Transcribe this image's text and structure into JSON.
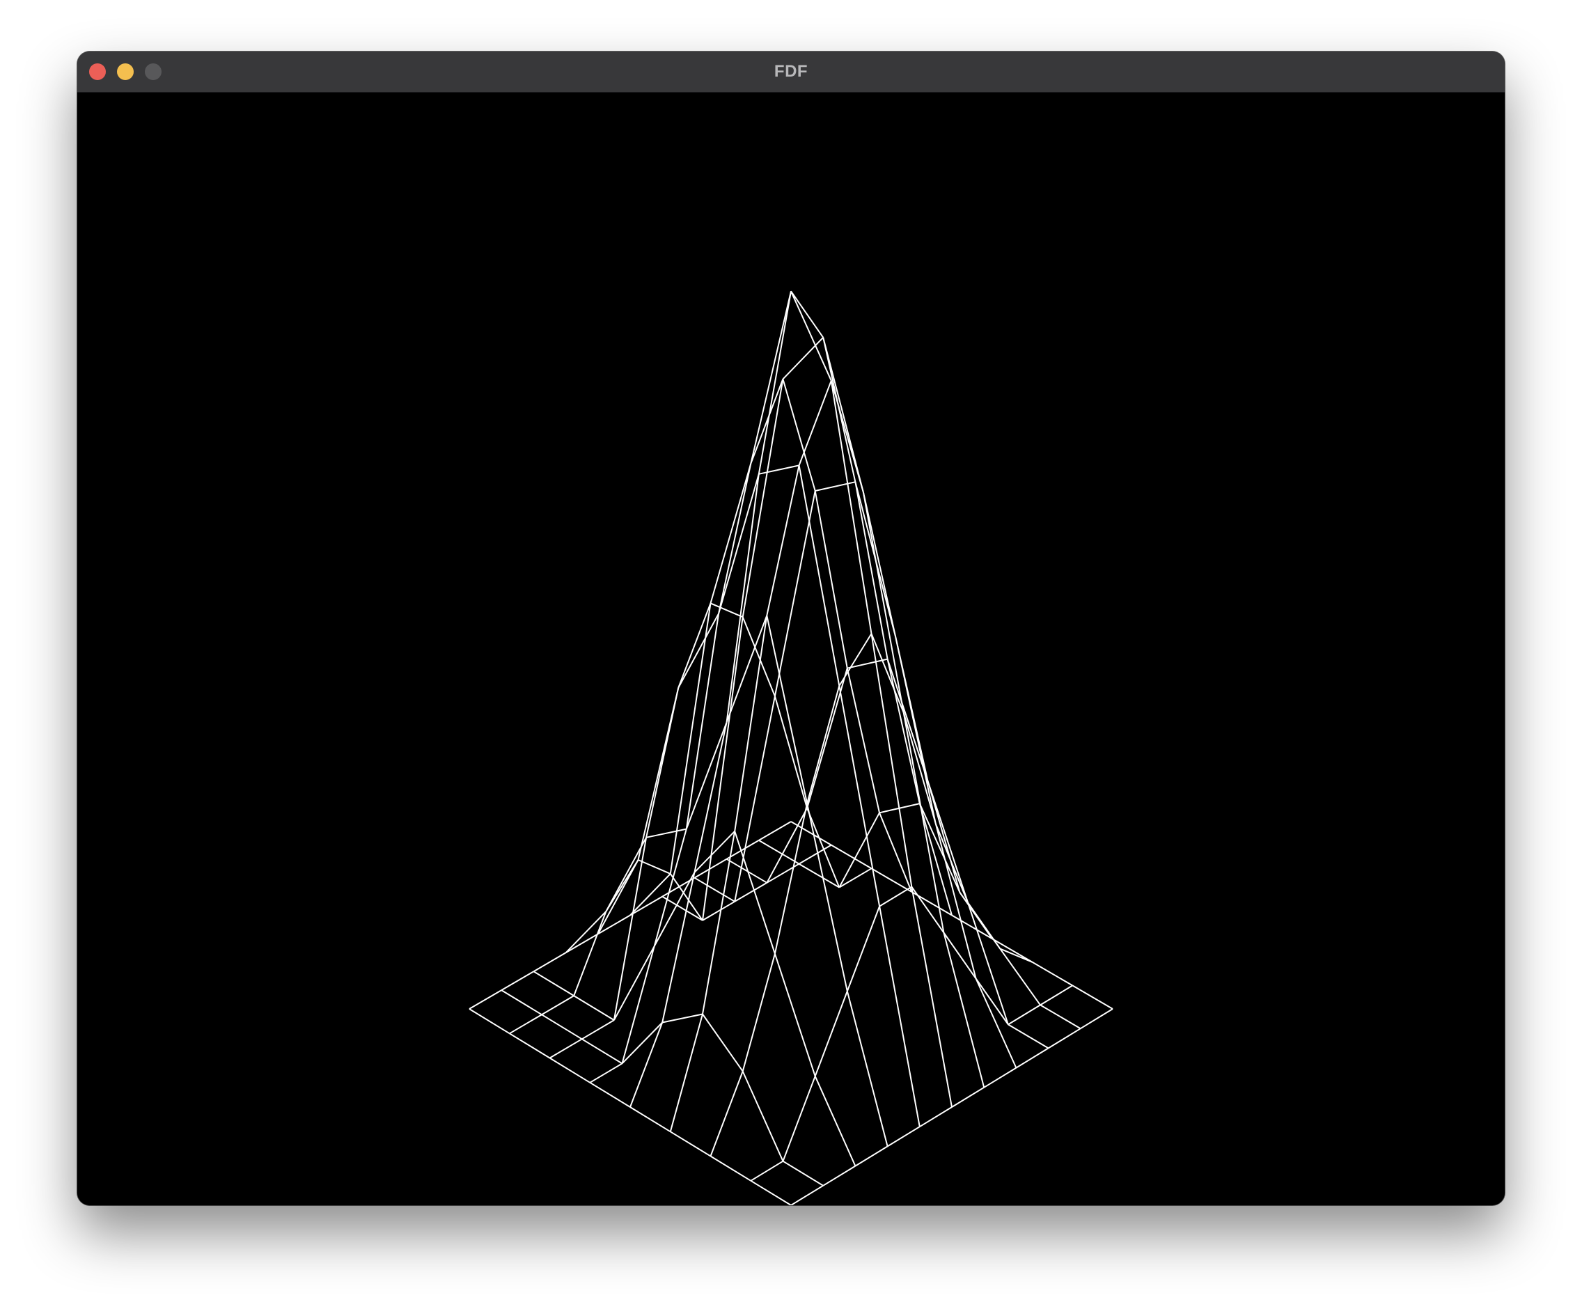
{
  "window": {
    "title": "FDF",
    "traffic_lights": {
      "close_color": "#ec5f57",
      "minimize_color": "#f4bf4f",
      "zoom_color": "#58585a"
    }
  },
  "canvas": {
    "background": "#000000",
    "wire_color": "#ffffff",
    "projection": "isometric",
    "heightmap": [
      [
        0,
        0,
        0,
        0,
        0,
        0,
        0,
        0,
        0,
        0,
        0
      ],
      [
        0,
        0,
        0,
        2,
        3,
        2,
        0,
        0,
        0,
        0,
        0
      ],
      [
        0,
        0,
        0,
        5,
        9,
        11,
        10,
        7,
        3,
        0,
        0
      ],
      [
        0,
        0,
        3,
        6,
        12,
        16,
        18,
        14,
        8,
        3,
        0
      ],
      [
        0,
        2,
        6,
        10,
        17,
        22,
        20,
        15,
        9,
        4,
        0
      ],
      [
        0,
        3,
        8,
        14,
        18,
        20,
        16,
        11,
        6,
        2,
        0
      ],
      [
        0,
        2,
        5,
        9,
        12,
        13,
        10,
        6,
        3,
        1,
        0
      ],
      [
        0,
        0,
        2,
        4,
        6,
        6,
        4,
        2,
        0,
        0,
        0
      ],
      [
        0,
        0,
        0,
        0,
        0,
        0,
        0,
        0,
        0,
        0,
        0
      ]
    ]
  }
}
